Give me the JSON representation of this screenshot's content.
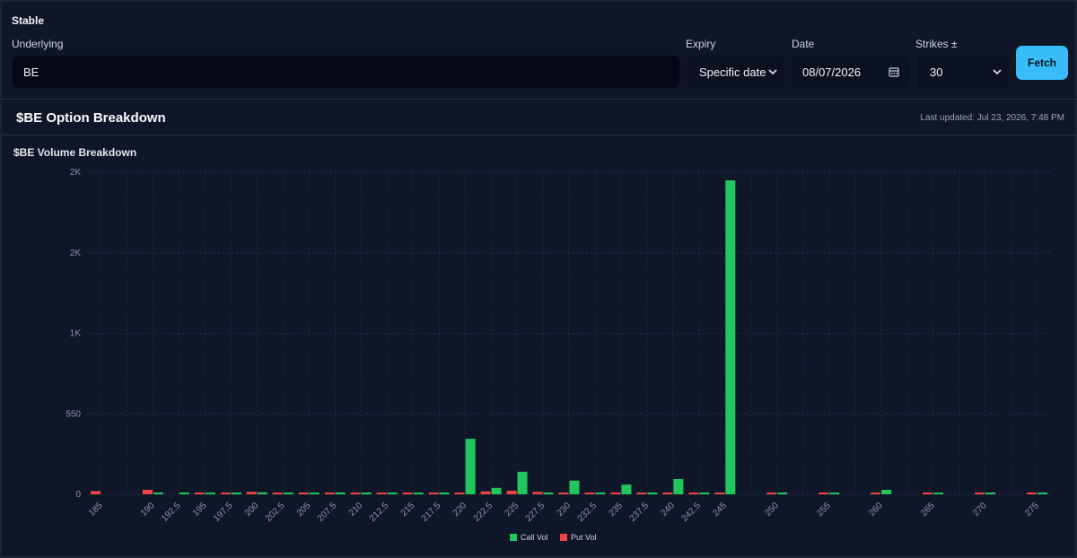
{
  "controls": {
    "section_label": "Stable",
    "underlying_label": "Underlying",
    "underlying_value": "BE",
    "expiry_label": "Expiry",
    "expiry_value": "Specific date",
    "date_label": "Date",
    "date_value": "08/07/2026",
    "strikes_label": "Strikes ±",
    "strikes_value": "30",
    "fetch_label": "Fetch"
  },
  "header": {
    "title": "$BE Option Breakdown",
    "last_updated": "Last updated: Jul 23, 2026, 7:48 PM"
  },
  "colors": {
    "call": "#22c55e",
    "put": "#ef4444",
    "background": "#0f1628",
    "accent": "#38bdf8"
  },
  "chart_data": {
    "type": "bar",
    "title": "$BE Volume Breakdown",
    "categories": [
      "185",
      "187.5",
      "190",
      "192.5",
      "195",
      "197.5",
      "200",
      "202.5",
      "205",
      "207.5",
      "210",
      "212.5",
      "215",
      "217.5",
      "220",
      "222.5",
      "225",
      "227.5",
      "230",
      "232.5",
      "235",
      "237.5",
      "240",
      "242.5",
      "245",
      "247.5",
      "250",
      "252.5",
      "255",
      "257.5",
      "260",
      "262.5",
      "265",
      "267.5",
      "270",
      "272.5",
      "275"
    ],
    "tick_labels": [
      "185",
      "190",
      "192.5",
      "195",
      "197.5",
      "200",
      "202.5",
      "205",
      "207.5",
      "210",
      "212.5",
      "215",
      "217.5",
      "220",
      "222.5",
      "225",
      "227.5",
      "230",
      "232.5",
      "235",
      "237.5",
      "240",
      "242.5",
      "245",
      "250",
      "255",
      "260",
      "265",
      "270",
      "275"
    ],
    "series": [
      {
        "name": "Call Vol",
        "color": "#22c55e",
        "values": [
          0,
          0,
          2,
          8,
          8,
          3,
          12,
          1,
          2,
          12,
          7,
          5,
          8,
          8,
          345,
          40,
          140,
          6,
          85,
          10,
          60,
          8,
          95,
          2,
          1950,
          0,
          4,
          0,
          10,
          0,
          28,
          0,
          8,
          0,
          6,
          0,
          6
        ]
      },
      {
        "name": "Put Vol",
        "color": "#ef4444",
        "values": [
          20,
          0,
          28,
          0,
          2,
          1,
          15,
          2,
          1,
          3,
          6,
          4,
          2,
          4,
          10,
          18,
          22,
          15,
          8,
          5,
          2,
          4,
          2,
          3,
          4,
          0,
          3,
          0,
          2,
          0,
          3,
          0,
          2,
          0,
          2,
          0,
          2
        ]
      }
    ],
    "y_ticks": [
      {
        "value": 0,
        "label": "0"
      },
      {
        "value": 500,
        "label": "550"
      },
      {
        "value": 1000,
        "label": "1K"
      },
      {
        "value": 1500,
        "label": "2K"
      },
      {
        "value": 2000,
        "label": "2K"
      }
    ],
    "ylim": [
      0,
      2000
    ],
    "grid": true,
    "legend_position": "bottom-center"
  }
}
